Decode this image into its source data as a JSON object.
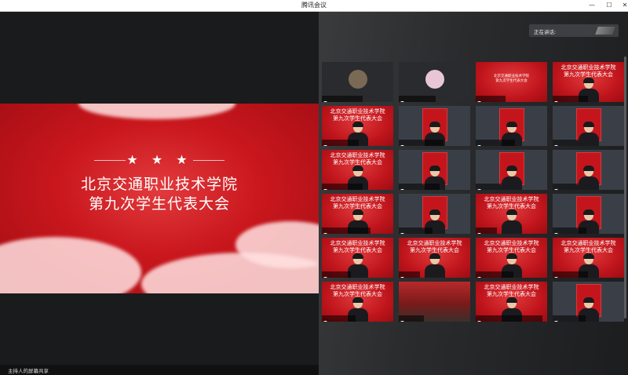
{
  "window": {
    "title": "腾讯会议",
    "controls": [
      "—",
      "☐",
      "✕"
    ]
  },
  "stage": {
    "slide_title_line1": "北京交通职业技术学院",
    "slide_title_line2": "第九次学生代表大会",
    "stars": "★ ★ ★",
    "footer_label": "主持人的屏幕共享"
  },
  "speaking": {
    "label": "正在讲话:"
  },
  "tile_slide_header_1": "北京交通职业技术学院",
  "tile_slide_header_2": "第九次学生代表大会",
  "tiles": [
    {
      "name": "主持人的屏幕共享",
      "kind": "avatar",
      "avatar_color": "#7a6a55"
    },
    {
      "name": "21级旅游2李凯",
      "kind": "avatar",
      "avatar_color": "#e8c6d8"
    },
    {
      "name": "20城轨王宇",
      "kind": "slide_small"
    },
    {
      "name": "吕欣23-副主席",
      "kind": "slide_person"
    },
    {
      "name": "21级铁路7尹欣",
      "kind": "slide_person"
    },
    {
      "name": "21级城轨机电2刘晴",
      "kind": "poster"
    },
    {
      "name": "内机1602张雨晴",
      "kind": "poster"
    },
    {
      "name": "黄蓉鹏32",
      "kind": "poster_person"
    },
    {
      "name": "21大数据应用3何",
      "kind": "slide_person"
    },
    {
      "name": "21机电技术3胡江",
      "kind": "poster"
    },
    {
      "name": "刘冉冉05",
      "kind": "poster_person"
    },
    {
      "name": "路桥环27",
      "kind": "poster_person"
    },
    {
      "name": "道桥共工程3班-刘王坤",
      "kind": "slide_person"
    },
    {
      "name": "无人机19刘坤",
      "kind": "poster_person"
    },
    {
      "name": "杨振宇",
      "kind": "slide_person"
    },
    {
      "name": "21大数据李鹏",
      "kind": "poster_person"
    },
    {
      "name": "一体化机组",
      "kind": "slide_person"
    },
    {
      "name": "李新松",
      "kind": "slide_person"
    },
    {
      "name": "21交通运输刘婷",
      "kind": "slide_person"
    },
    {
      "name": "21机电-张婷婷",
      "kind": "slide_person"
    },
    {
      "name": "20自动化杨敏",
      "kind": "slide_person"
    },
    {
      "name": "园林金鑫",
      "kind": "room"
    },
    {
      "name": "轨道交通系2020级运营管理赵刚",
      "kind": "slide_person"
    },
    {
      "name": "21运营3吴刚",
      "kind": "poster_person"
    }
  ],
  "colors": {
    "slide_red": "#c9171d",
    "tile_bg": "#2e2f32",
    "panel": "#2a2b2d"
  }
}
